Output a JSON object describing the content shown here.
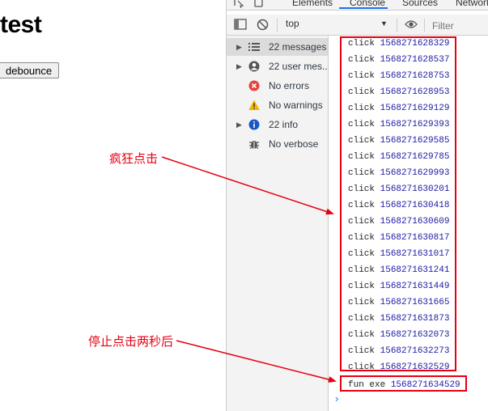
{
  "page": {
    "title": "test",
    "button_label": "debounce"
  },
  "devtools": {
    "tabs": [
      "Elements",
      "Console",
      "Sources",
      "Network"
    ],
    "active_tab": "Console",
    "context": "top",
    "filter_placeholder": "Filter",
    "sidebar": [
      {
        "label": "22 messages",
        "icon": "list-icon",
        "expandable": true,
        "selected": true
      },
      {
        "label": "22 user mes...",
        "icon": "user-icon",
        "expandable": true,
        "selected": false
      },
      {
        "label": "No errors",
        "icon": "error-icon",
        "expandable": false,
        "selected": false
      },
      {
        "label": "No warnings",
        "icon": "warning-icon",
        "expandable": false,
        "selected": false
      },
      {
        "label": "22 info",
        "icon": "info-icon",
        "expandable": true,
        "selected": false
      },
      {
        "label": "No verbose",
        "icon": "bug-icon",
        "expandable": false,
        "selected": false
      }
    ],
    "logs": [
      {
        "text": "click",
        "value": "1568271628329"
      },
      {
        "text": "click",
        "value": "1568271628537"
      },
      {
        "text": "click",
        "value": "1568271628753"
      },
      {
        "text": "click",
        "value": "1568271628953"
      },
      {
        "text": "click",
        "value": "1568271629129"
      },
      {
        "text": "click",
        "value": "1568271629393"
      },
      {
        "text": "click",
        "value": "1568271629585"
      },
      {
        "text": "click",
        "value": "1568271629785"
      },
      {
        "text": "click",
        "value": "1568271629993"
      },
      {
        "text": "click",
        "value": "1568271630201"
      },
      {
        "text": "click",
        "value": "1568271630418"
      },
      {
        "text": "click",
        "value": "1568271630609"
      },
      {
        "text": "click",
        "value": "1568271630817"
      },
      {
        "text": "click",
        "value": "1568271631017"
      },
      {
        "text": "click",
        "value": "1568271631241"
      },
      {
        "text": "click",
        "value": "1568271631449"
      },
      {
        "text": "click",
        "value": "1568271631665"
      },
      {
        "text": "click",
        "value": "1568271631873"
      },
      {
        "text": "click",
        "value": "1568271632073"
      },
      {
        "text": "click",
        "value": "1568271632273"
      },
      {
        "text": "click",
        "value": "1568271632529"
      },
      {
        "text": "fun exe",
        "value": "1568271634529"
      }
    ],
    "prompt": "›"
  },
  "annotations": {
    "crazy_click": "疯狂点击",
    "after_stop": "停止点击两秒后"
  },
  "colors": {
    "annotation": "#e60012",
    "log_number": "#1a1aa6",
    "accent": "#1a73e8"
  }
}
